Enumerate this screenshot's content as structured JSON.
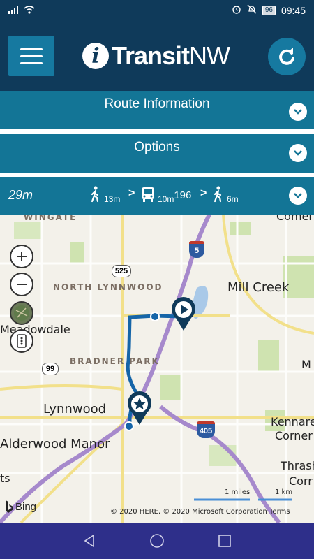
{
  "statusbar": {
    "battery": "96",
    "time": "09:45"
  },
  "app": {
    "logo_i": "i",
    "logo_bold": "Transit",
    "logo_light": "NW"
  },
  "panels": {
    "route_info": "Route Information",
    "options": "Options"
  },
  "trip": {
    "total": "29m",
    "walk1": "13m",
    "bus_time": "10m",
    "bus_route": "196",
    "walk2": "6m",
    "arrow": ">"
  },
  "map": {
    "labels": {
      "wingate": "WINGATE",
      "north_lynnwood": "NORTH LYNNWOOD",
      "mill_creek": "Mill Creek",
      "meadowdale": "Meadowdale",
      "bradner_park": "BRADNER PARK",
      "lynnwood": "Lynnwood",
      "alderwood_manor": "Alderwood Manor",
      "kenmore_corner": "Kennare",
      "corner": "Corner",
      "thrash": "Thrash",
      "corr": "Corr",
      "m": "M",
      "comer": "Comer",
      "ts": "ts"
    },
    "shields": {
      "i5": "5",
      "sr525": "525",
      "sr99": "99",
      "i405": "405"
    },
    "scale_miles": "1 miles",
    "scale_km": "1 km",
    "copyright": "© 2020 HERE, © 2020 Microsoft Corporation Terms",
    "bing": "Bing"
  },
  "colors": {
    "appbar": "#0f3a5a",
    "panel": "#137596",
    "route": "#1565a8",
    "navbar": "#2e2f8a"
  }
}
